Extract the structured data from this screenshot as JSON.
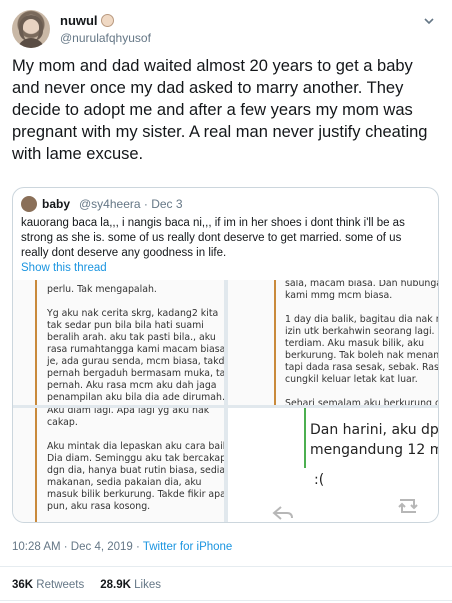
{
  "author": {
    "name": "nuwul",
    "handle": "@nurulafqhyusof"
  },
  "tweet": {
    "text": "My mom and dad waited almost 20 years to get a baby and never once my dad asked to marry another. They decide to adopt me and after a few years my mom was pregnant with my sister. A real man never justify cheating with lame excuse."
  },
  "quoted": {
    "name": "baby",
    "handle_date": "@sy4heera · Dec 3",
    "text": "kauorang baca la,,, i nangis baca ni,,, if im in her shoes i dont think i'll be as strong as she is. some of us really dont deserve to get married. some of us really dont deserve any goodness in life.",
    "show_thread": "Show this thread",
    "images": {
      "top_left": "perlu. Tak mengapalah.\n\nYg aku nak cerita skrg, kadang2 kita\ntak sedar pun bila bila hati suami\nberalih arah. aku tak pasti bila., aku\nrasa rumahtangga kami macam biasa\nje, ada gurau senda, mcm biasa, takde\npernah bergaduh bermasam muka, tak\npernah. Aku rasa mcm aku dah jaga\npenampilan aku bila dia ade dirumah.",
      "top_right": "sala, macam biasa. Dan hubungan\nkami mmg mcm biasa.\n\n1 day dia balik, bagitau dia nak mintak\nizin utk berkahwin seorang lagi. aku\nterdiam. Aku masuk bilik, aku\nberkurung. Tak boleh nak menangis,\ntapi dada rasa sesak, sebak. Rasa nak\ncungkil keluar letak kat luar.\n\nSehari semalam aku berkurung dalam\nbilik. Tak keluar tak makan. Aku cari",
      "bottom_left": "Aku diam lagi. Apa lagi yg aku nak\ncakap.\n\nAku mintak dia lepaskan aku cara baik.\nDia diam. Seminggu aku tak bercakap\ndgn dia, hanya buat rutin biasa, sedia\nmakanan, sedia pakaian dia, aku\nmasuk bilik berkurung. Takde fikir apa2\npun, aku rasa kosong.\n\nMasuk minggu kedua, perempuan tu\nsekali pun takde dtg jumpa aku.",
      "bottom_right": "Dan harini, aku dpt\nmengandung 12 m",
      "bottom_right_face": ":("
    }
  },
  "meta": {
    "time_date": "10:28 AM · Dec 4, 2019 · ",
    "source": "Twitter for iPhone"
  },
  "stats": {
    "retweets_count": "36K",
    "retweets_label": " Retweets",
    "likes_count": "28.9K",
    "likes_label": " Likes"
  }
}
